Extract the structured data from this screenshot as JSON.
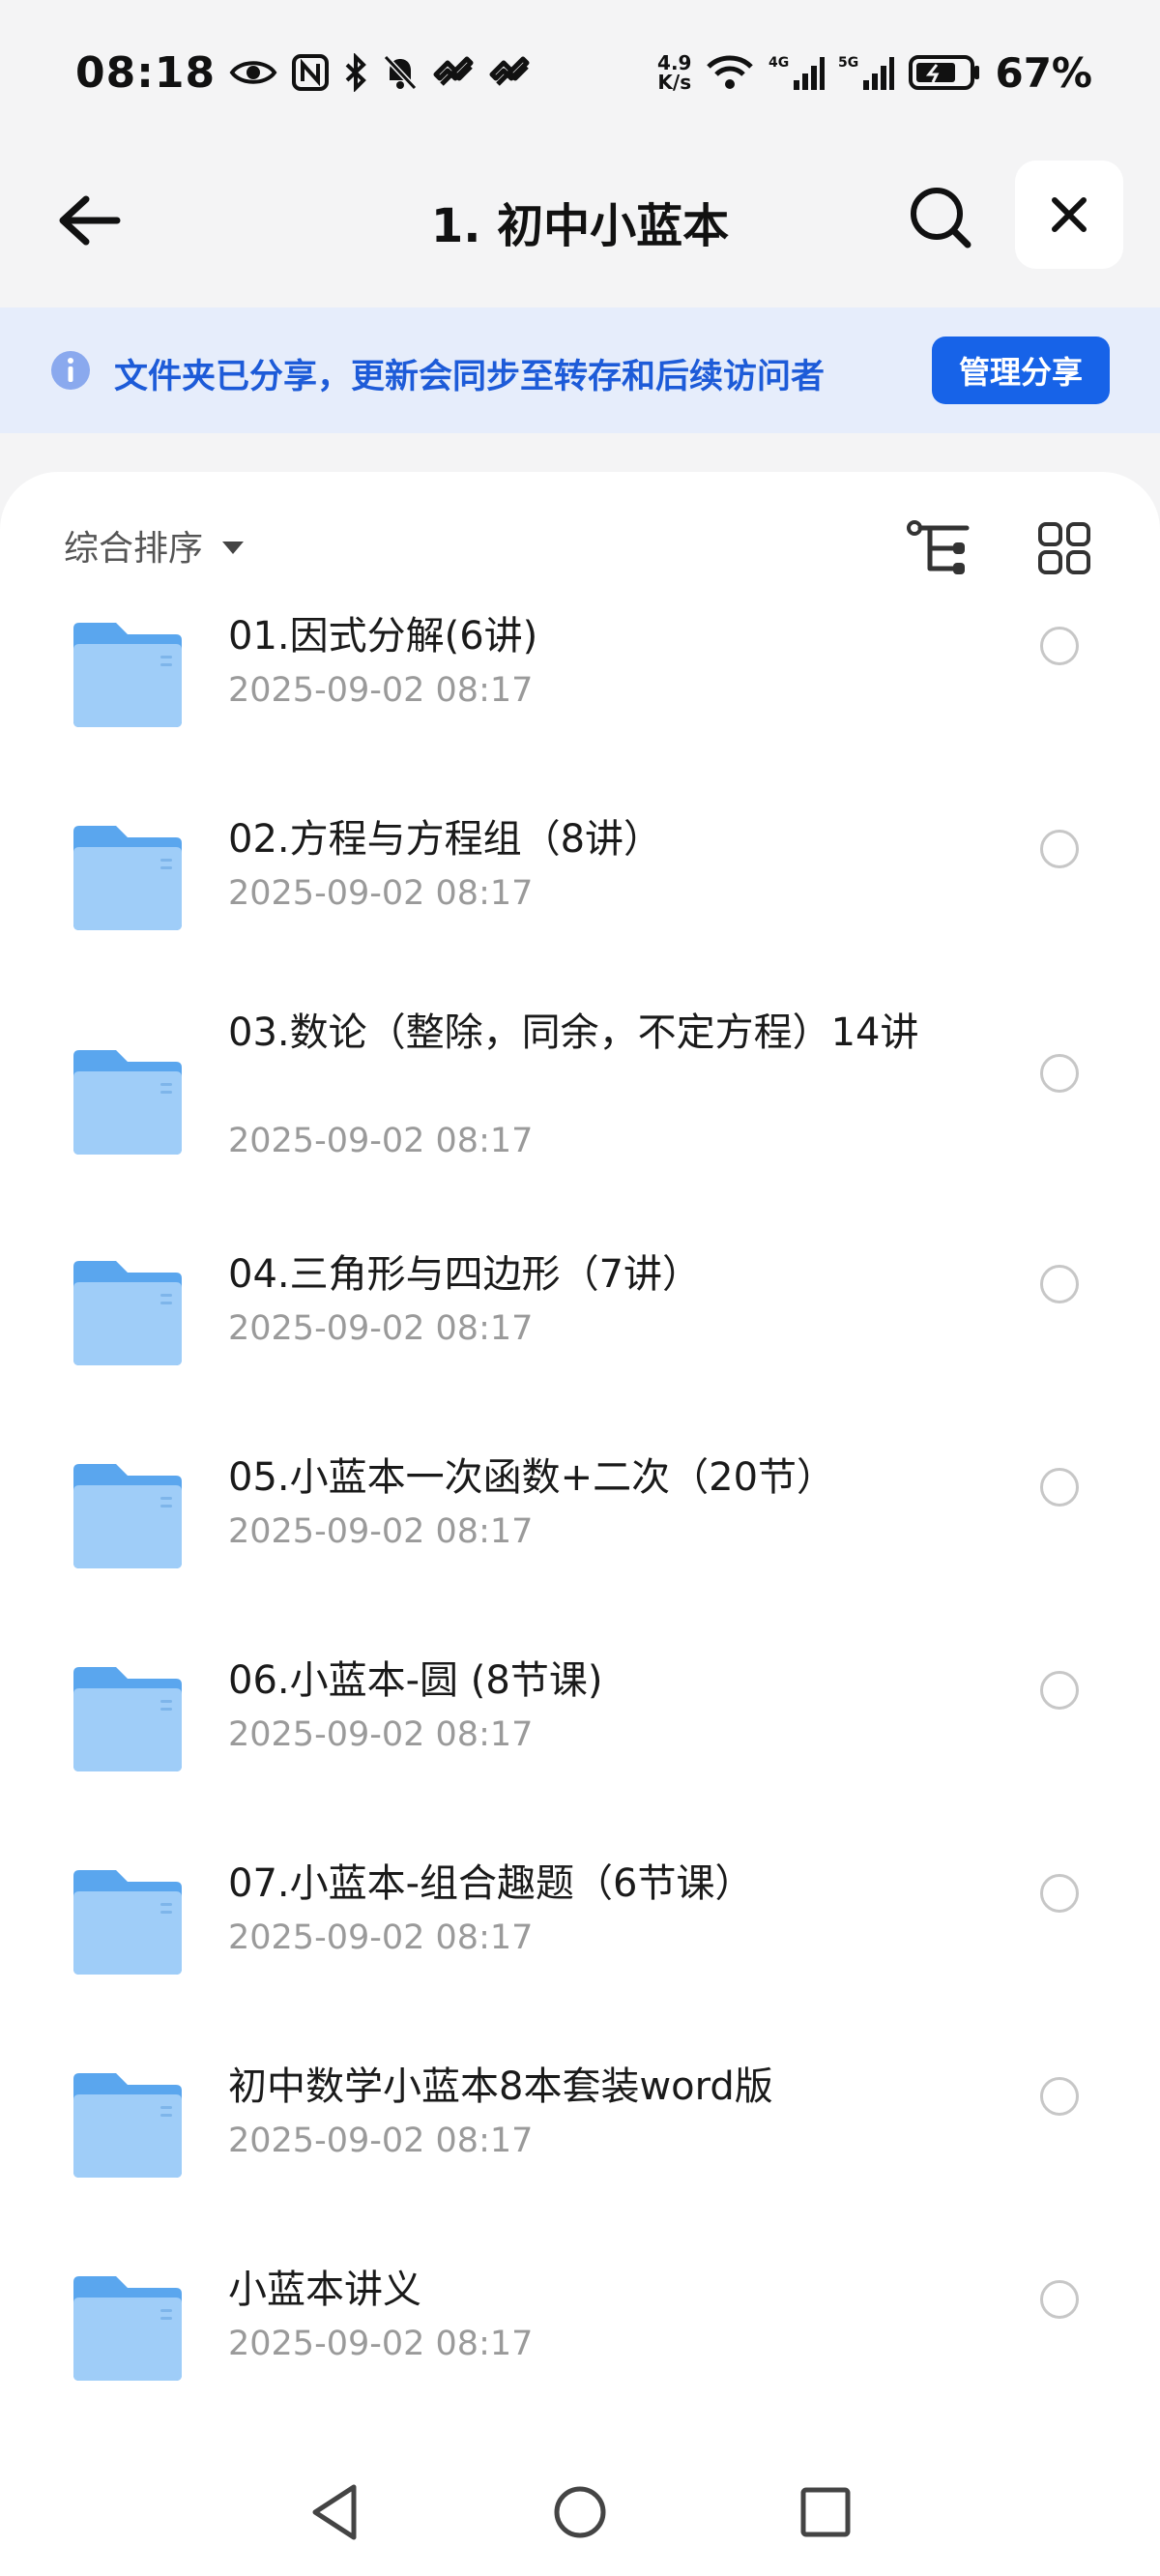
{
  "status_bar": {
    "time": "08:18",
    "icons": [
      "eye-icon",
      "nfc-icon",
      "bluetooth-icon",
      "mute-icon",
      "app-icon",
      "app-icon"
    ],
    "net_speed_value": "4.9",
    "net_speed_unit": "K/s",
    "network_4g": "4G",
    "network_5g": "5G",
    "battery_percent": "67%"
  },
  "header": {
    "title": "1. 初中小蓝本",
    "back_icon": "arrow-left-icon",
    "search_icon": "search-icon",
    "close_icon": "close-icon"
  },
  "banner": {
    "text": "文件夹已分享，更新会同步至转存和后续访问者",
    "button_label": "管理分享",
    "accent": "#1763e8"
  },
  "toolbar": {
    "sort_label": "综合排序"
  },
  "files": [
    {
      "name": "01.因式分解(6讲)",
      "date": "2025-09-02 08:17"
    },
    {
      "name": "02.方程与方程组（8讲）",
      "date": "2025-09-02 08:17"
    },
    {
      "name": "03.数论（整除，同余，不定方程）14讲",
      "date": "2025-09-02 08:17"
    },
    {
      "name": "04.三角形与四边形（7讲）",
      "date": "2025-09-02 08:17"
    },
    {
      "name": "05.小蓝本一次函数+二次（20节）",
      "date": "2025-09-02 08:17"
    },
    {
      "name": "06.小蓝本-圆 (8节课)",
      "date": "2025-09-02 08:17"
    },
    {
      "name": "07.小蓝本-组合趣题（6节课）",
      "date": "2025-09-02 08:17"
    },
    {
      "name": "初中数学小蓝本8本套装word版",
      "date": "2025-09-02 08:17"
    },
    {
      "name": "小蓝本讲义",
      "date": "2025-09-02 08:17"
    }
  ],
  "nav": {
    "back_icon": "nav-back-icon",
    "home_icon": "nav-home-icon",
    "recents_icon": "nav-recents-icon"
  }
}
